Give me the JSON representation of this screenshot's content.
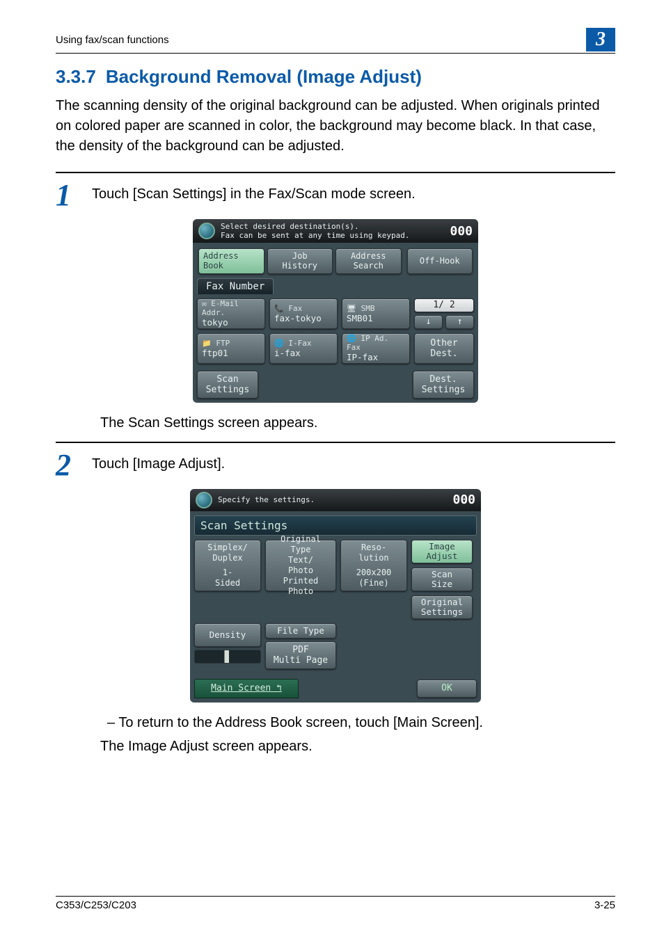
{
  "header": {
    "running": "Using fax/scan functions",
    "chapter": "3"
  },
  "section": {
    "number": "3.3.7",
    "title": "Background Removal (Image Adjust)"
  },
  "intro": "The scanning density of the original background can be adjusted. When originals printed on colored paper are scanned in color, the background may become black. In that case, the density of the background can be adjusted.",
  "steps": {
    "s1": {
      "num": "1",
      "text": "Touch [Scan Settings] in the Fax/Scan mode screen.",
      "after": "The Scan Settings screen appears."
    },
    "s2": {
      "num": "2",
      "text": "Touch [Image Adjust].",
      "bullet": "To return to the Address Book screen, touch [Main Screen].",
      "after": "The Image Adjust screen appears."
    }
  },
  "screen1": {
    "hdr1": "Select desired destination(s).",
    "hdr2": "Fax can be sent at any time using keypad.",
    "counter": "000",
    "tabs": {
      "addrbook": "Address\nBook",
      "jobhist": "Job\nHistory",
      "addrsearch": "Address\nSearch",
      "offhook": "Off-Hook"
    },
    "faxnumber": "Fax Number",
    "dest": {
      "email": {
        "t": "E-Mail\nAddr.",
        "v": "tokyo"
      },
      "fax": {
        "t": "Fax",
        "v": "fax-tokyo"
      },
      "smb": {
        "t": "SMB",
        "v": "SMB01"
      },
      "ftp": {
        "t": "FTP",
        "v": "ftp01"
      },
      "ifax": {
        "t": "I-Fax",
        "v": "i-fax"
      },
      "ipfax": {
        "t": "IP Ad.\nFax",
        "v": "IP-fax"
      }
    },
    "pager": {
      "page": "1/  2"
    },
    "other": "Other\nDest.",
    "scansettings": "Scan\nSettings",
    "destsettings": "Dest.\nSettings"
  },
  "screen2": {
    "hdr": "Specify the settings.",
    "counter": "000",
    "title": "Scan Settings",
    "simplex": {
      "t": "Simplex/\nDuplex",
      "v": "1-\nSided"
    },
    "origtype": {
      "t": "Original\nType",
      "v": "Text/\nPhoto",
      "v2": "Printed\nPhoto"
    },
    "resolution": {
      "t": "Reso-\nlution",
      "v": "200x200\n(Fine)"
    },
    "density": "Density",
    "filetype": {
      "t": "File Type",
      "v": "PDF\nMulti Page"
    },
    "right": {
      "imageadjust": "Image\nAdjust",
      "scansize": "Scan\nSize",
      "origset": "Original\nSettings"
    },
    "mainscreen": "Main Screen ↰",
    "ok": "OK"
  },
  "footer": {
    "left": "C353/C253/C203",
    "right": "3-25"
  }
}
